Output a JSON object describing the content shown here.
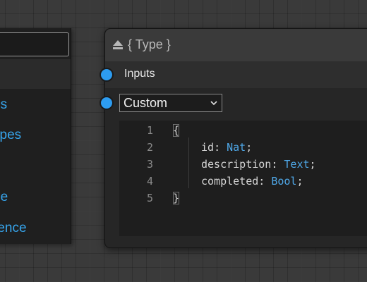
{
  "left_panel": {
    "search_value": "",
    "items": [
      {
        "label": "es"
      },
      {
        "label": "ypes"
      },
      {
        "label": "pe"
      },
      {
        "label": "rence"
      }
    ]
  },
  "node": {
    "title": "{ Type }",
    "title_icon": "eject-icon",
    "inputs_label": "Inputs",
    "select": {
      "value": "Custom"
    },
    "editor": {
      "lines": [
        {
          "num": "1",
          "text": "{"
        },
        {
          "num": "2",
          "field": "id",
          "type": "Nat"
        },
        {
          "num": "3",
          "field": "description",
          "type": "Text"
        },
        {
          "num": "4",
          "field": "completed",
          "type": "Bool"
        },
        {
          "num": "5",
          "text": "}"
        }
      ]
    }
  },
  "colors": {
    "accent": "#2d9cf0",
    "link": "#37a6ee",
    "type_keyword": "#4fa8e8"
  }
}
